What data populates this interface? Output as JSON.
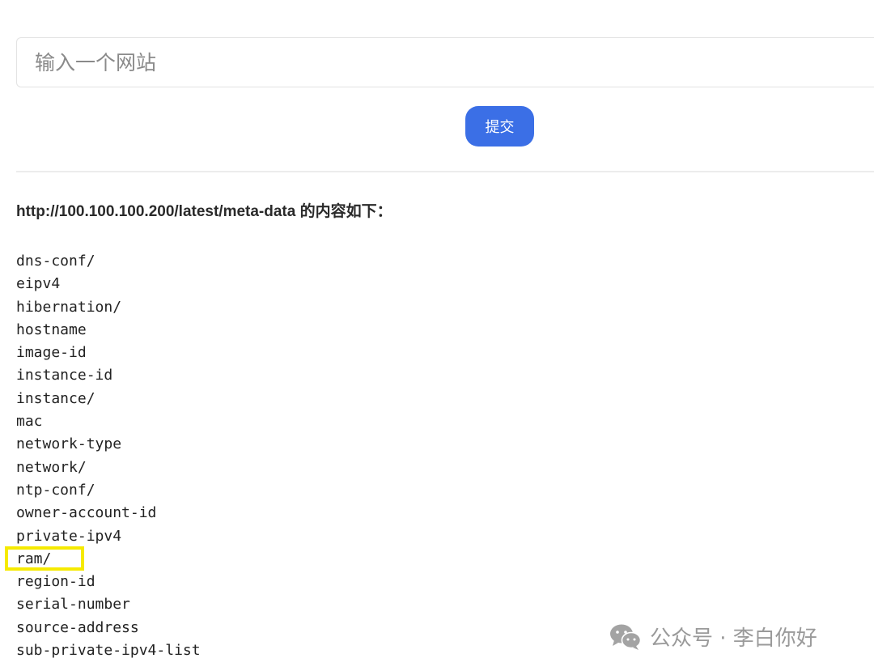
{
  "form": {
    "url_placeholder": "输入一个网站",
    "url_value": "",
    "submit_label": "提交"
  },
  "result": {
    "heading": "http://100.100.100.200/latest/meta-data 的内容如下：",
    "items": [
      "dns-conf/",
      "eipv4",
      "hibernation/",
      "hostname",
      "image-id",
      "instance-id",
      "instance/",
      "mac",
      "network-type",
      "network/",
      "ntp-conf/",
      "owner-account-id",
      "private-ipv4",
      "ram/",
      "region-id",
      "serial-number",
      "source-address",
      "sub-private-ipv4-list"
    ],
    "highlighted_item": "ram/"
  },
  "watermark": {
    "icon": "wechat-icon",
    "text": "公众号 · 李白你好"
  },
  "colors": {
    "accent": "#3b6fe6",
    "highlight": "#f6ea00"
  }
}
